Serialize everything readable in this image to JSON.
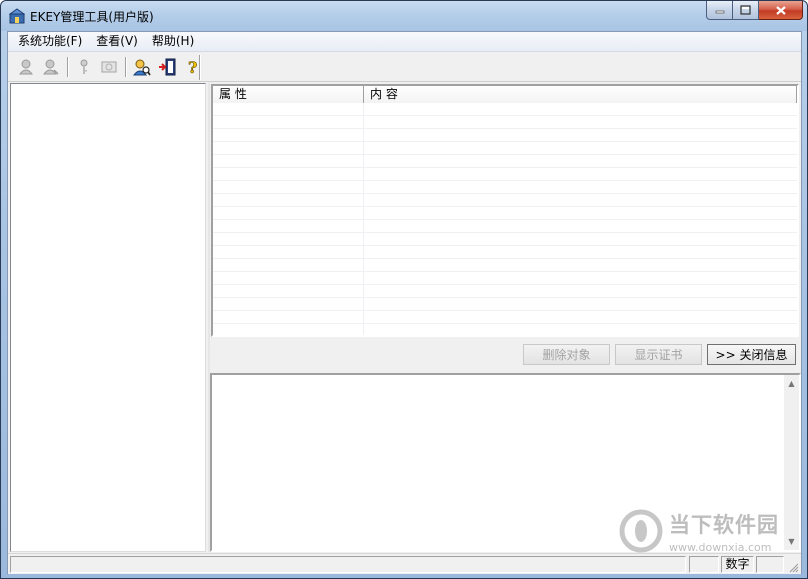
{
  "window": {
    "title": "EKEY管理工具(用户版)"
  },
  "menu": {
    "items": [
      {
        "label": "系统功能(F)"
      },
      {
        "label": "查看(V)"
      },
      {
        "label": "帮助(H)"
      }
    ]
  },
  "toolbar": {
    "buttons": [
      {
        "icon": "user-login-icon",
        "enabled": false
      },
      {
        "icon": "user-logout-icon",
        "enabled": false
      },
      {
        "icon": "key-icon",
        "enabled": false
      },
      {
        "icon": "certificate-icon",
        "enabled": false
      },
      {
        "icon": "user-search-icon",
        "enabled": true
      },
      {
        "icon": "exit-door-icon",
        "enabled": true
      },
      {
        "icon": "help-icon",
        "enabled": true
      }
    ]
  },
  "properties_table": {
    "columns": [
      "属 性",
      "内 容"
    ],
    "rows": []
  },
  "actions": {
    "delete_object": "删除对象",
    "show_certificate": "显示证书",
    "close_info": ">> 关闭信息"
  },
  "statusbar": {
    "num_indicator": "数字"
  },
  "watermark": {
    "title": "当下软件园",
    "url": "www.downxia.com"
  },
  "colors": {
    "title_bar": "#b3cde9",
    "close_button": "#c23a23",
    "disabled_text": "#a3a3a3"
  }
}
